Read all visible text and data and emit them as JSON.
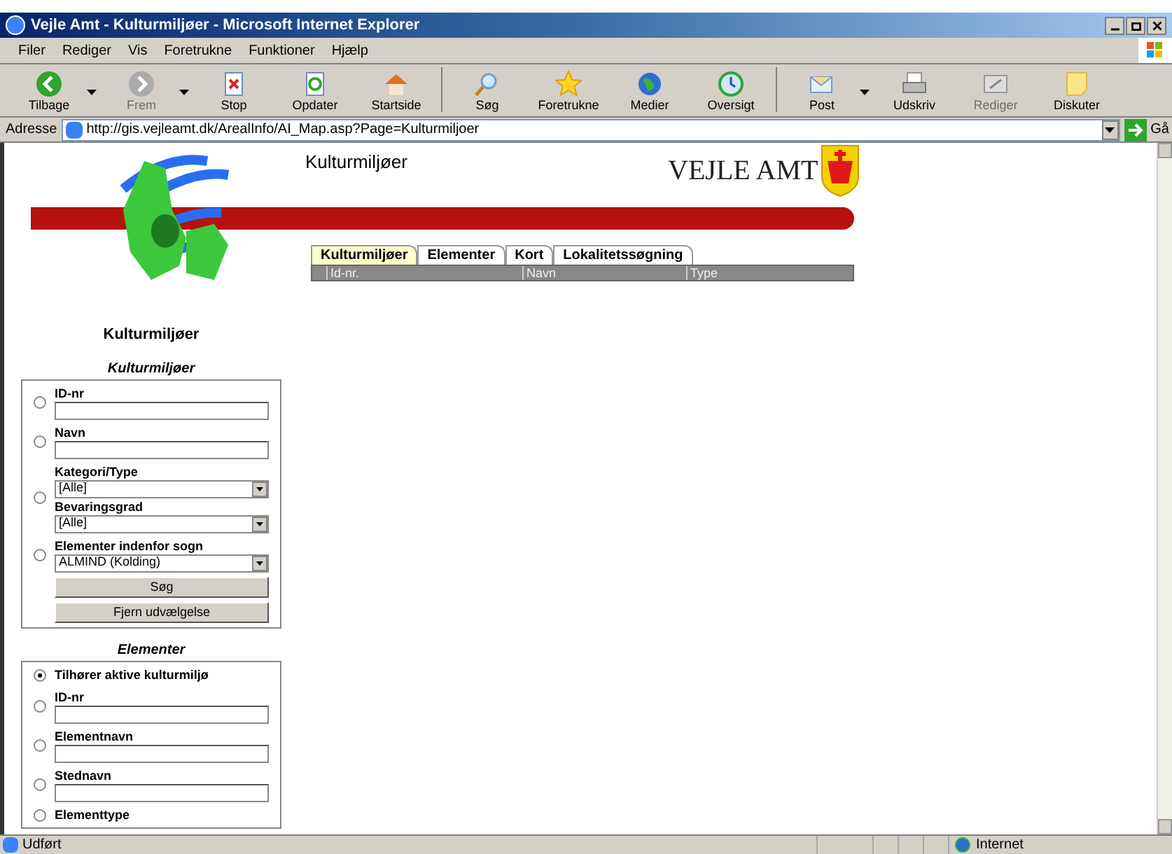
{
  "window": {
    "title": "Vejle Amt - Kulturmiljøer - Microsoft Internet Explorer"
  },
  "menu": [
    "Filer",
    "Rediger",
    "Vis",
    "Foretrukne",
    "Funktioner",
    "Hjælp"
  ],
  "toolbar": [
    {
      "kind": "back",
      "label": "Tilbage",
      "disabled": false,
      "dropdown": true
    },
    {
      "kind": "forward",
      "label": "Frem",
      "disabled": true,
      "dropdown": true
    },
    {
      "kind": "stop",
      "label": "Stop",
      "disabled": false,
      "dropdown": false
    },
    {
      "kind": "refresh",
      "label": "Opdater",
      "disabled": false,
      "dropdown": false
    },
    {
      "kind": "home",
      "label": "Startside",
      "disabled": false,
      "dropdown": false
    },
    {
      "kind": "search",
      "label": "Søg",
      "disabled": false,
      "dropdown": false
    },
    {
      "kind": "favorites",
      "label": "Foretrukne",
      "disabled": false,
      "dropdown": false
    },
    {
      "kind": "media",
      "label": "Medier",
      "disabled": false,
      "dropdown": false
    },
    {
      "kind": "history",
      "label": "Oversigt",
      "disabled": false,
      "dropdown": false
    },
    {
      "kind": "mail",
      "label": "Post",
      "disabled": false,
      "dropdown": true
    },
    {
      "kind": "print",
      "label": "Udskriv",
      "disabled": false,
      "dropdown": false
    },
    {
      "kind": "edit",
      "label": "Rediger",
      "disabled": true,
      "dropdown": false
    },
    {
      "kind": "discuss",
      "label": "Diskuter",
      "disabled": false,
      "dropdown": false
    }
  ],
  "address": {
    "label": "Adresse",
    "url": "http://gis.vejleamt.dk/ArealInfo/AI_Map.asp?Page=Kulturmiljoer",
    "go": "Gå"
  },
  "page": {
    "title": "Kulturmiljøer",
    "brand": "VEJLE AMT",
    "tabs": [
      {
        "label": "Kulturmiljøer",
        "selected": true
      },
      {
        "label": "Elementer",
        "selected": false
      },
      {
        "label": "Kort",
        "selected": false
      },
      {
        "label": "Lokalitetssøgning",
        "selected": false
      }
    ],
    "table": {
      "columns": [
        "Id-nr.",
        "Navn",
        "Type"
      ]
    },
    "sidebar": {
      "heading": "Kulturmiljøer",
      "sections": [
        {
          "title": "Kulturmiljøer",
          "options": [
            {
              "selected": false,
              "fields": [
                {
                  "kind": "text",
                  "label": "ID-nr"
                }
              ]
            },
            {
              "selected": false,
              "fields": [
                {
                  "kind": "text",
                  "label": "Navn"
                }
              ]
            },
            {
              "selected": false,
              "fields": [
                {
                  "kind": "select",
                  "label": "Kategori/Type",
                  "value": "[Alle]"
                },
                {
                  "kind": "select",
                  "label": "Bevaringsgrad",
                  "value": "[Alle]"
                }
              ]
            },
            {
              "selected": false,
              "fields": [
                {
                  "kind": "select",
                  "label": "Elementer indenfor sogn",
                  "value": "ALMIND (Kolding)"
                }
              ]
            }
          ],
          "buttons": [
            "Søg",
            "Fjern udvælgelse"
          ]
        },
        {
          "title": "Elementer",
          "options": [
            {
              "selected": true,
              "label": "Tilhører aktive kulturmiljø"
            },
            {
              "selected": false,
              "fields": [
                {
                  "kind": "text",
                  "label": "ID-nr"
                }
              ]
            },
            {
              "selected": false,
              "fields": [
                {
                  "kind": "text",
                  "label": "Elementnavn"
                }
              ]
            },
            {
              "selected": false,
              "fields": [
                {
                  "kind": "text",
                  "label": "Stednavn"
                }
              ]
            },
            {
              "selected": false,
              "fields": [
                {
                  "kind": "label",
                  "label": "Elementtype"
                }
              ]
            }
          ]
        }
      ]
    }
  },
  "status_bar": {
    "text": "Udført",
    "zone": "Internet"
  }
}
